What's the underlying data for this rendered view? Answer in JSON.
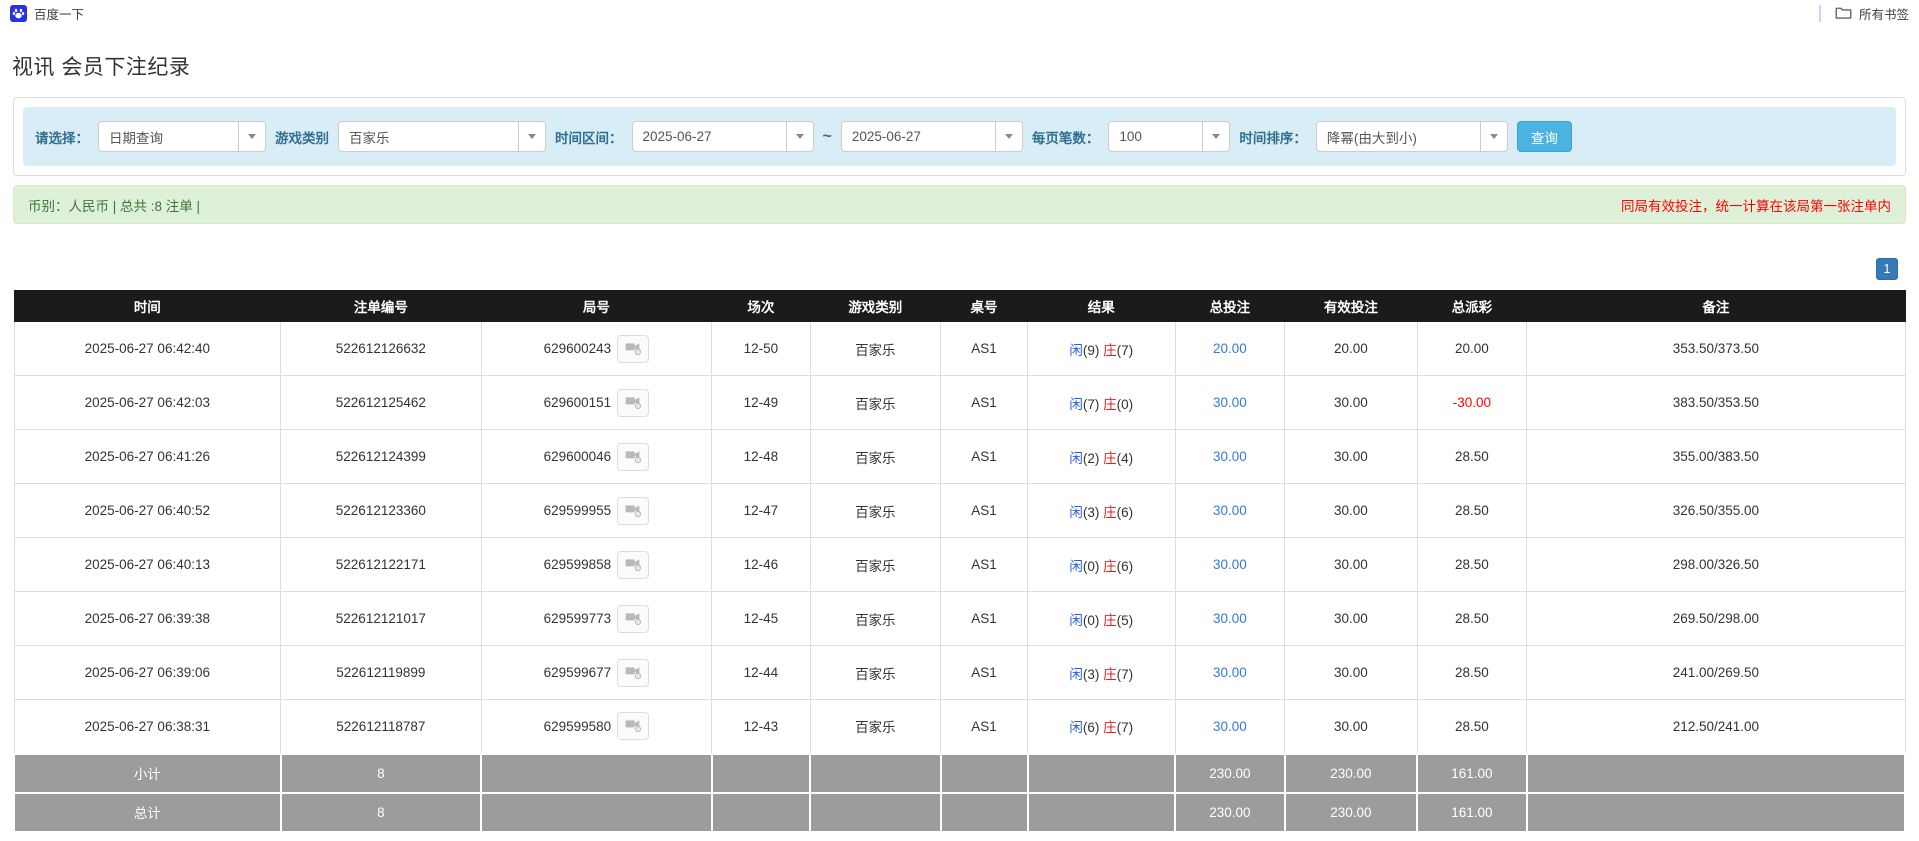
{
  "bookmarks_bar": {
    "baidu_label": "百度一下",
    "all_bookmarks_label": "所有书签"
  },
  "page": {
    "title": "视讯 会员下注纪录"
  },
  "filters": {
    "select_label": "请选择：",
    "select_value": "日期查询",
    "game_category_label": "游戏类别",
    "game_category_value": "百家乐",
    "time_range_label": "时间区间：",
    "date_from": "2025-06-27",
    "range_separator": "~",
    "date_to": "2025-06-27",
    "page_size_label": "每页笔数：",
    "page_size_value": "100",
    "sort_label": "时间排序：",
    "sort_value": "降幂(由大到小)",
    "search_button": "查询"
  },
  "summary_bar": {
    "left_text": "币别：人民币 | 总共 :8 注单 |",
    "right_text": "同局有效投注，统一计算在该局第一张注单内"
  },
  "pagination": {
    "current_page": "1"
  },
  "colors": {
    "filter_bg": "#d9edf7",
    "filter_label": "#31708f",
    "search_button_bg": "#4cb3e0",
    "summary_bg": "#dff0d8",
    "summary_text": "#3c763d",
    "notice_red": "#ff0000",
    "header_bg": "#1b1b1b",
    "player_blue": "#2b5fd9",
    "banker_red": "#e02222",
    "bet_link_blue": "#3579d8",
    "sum_row_bg": "#9c9c9c",
    "pagination_blue": "#337ab7",
    "baidu_blue": "#2932e1"
  },
  "table": {
    "headers": [
      "时间",
      "注单编号",
      "局号",
      "场次",
      "游戏类别",
      "桌号",
      "结果",
      "总投注",
      "有效投注",
      "总派彩",
      "备注"
    ],
    "col_widths": [
      "14.1%",
      "10.6%",
      "12.2%",
      "5.2%",
      "6.9%",
      "4.6%",
      "7.8%",
      "5.8%",
      "7.0%",
      "5.8%",
      "20.0%"
    ],
    "rows": [
      {
        "time": "2025-06-27 06:42:40",
        "bet_id": "522612126632",
        "round_id": "629600243",
        "session": "12-50",
        "game": "百家乐",
        "table_no": "AS1",
        "result": {
          "player": "闲",
          "player_count": "(9)",
          "banker": "庄",
          "banker_count": "(7)"
        },
        "total_bet": "20.00",
        "valid_bet": "20.00",
        "payout": "20.00",
        "remark": "353.50/373.50"
      },
      {
        "time": "2025-06-27 06:42:03",
        "bet_id": "522612125462",
        "round_id": "629600151",
        "session": "12-49",
        "game": "百家乐",
        "table_no": "AS1",
        "result": {
          "player": "闲",
          "player_count": "(7)",
          "banker": "庄",
          "banker_count": "(0)"
        },
        "total_bet": "30.00",
        "valid_bet": "30.00",
        "payout": "-30.00",
        "remark": "383.50/353.50"
      },
      {
        "time": "2025-06-27 06:41:26",
        "bet_id": "522612124399",
        "round_id": "629600046",
        "session": "12-48",
        "game": "百家乐",
        "table_no": "AS1",
        "result": {
          "player": "闲",
          "player_count": "(2)",
          "banker": "庄",
          "banker_count": "(4)"
        },
        "total_bet": "30.00",
        "valid_bet": "30.00",
        "payout": "28.50",
        "remark": "355.00/383.50"
      },
      {
        "time": "2025-06-27 06:40:52",
        "bet_id": "522612123360",
        "round_id": "629599955",
        "session": "12-47",
        "game": "百家乐",
        "table_no": "AS1",
        "result": {
          "player": "闲",
          "player_count": "(3)",
          "banker": "庄",
          "banker_count": "(6)"
        },
        "total_bet": "30.00",
        "valid_bet": "30.00",
        "payout": "28.50",
        "remark": "326.50/355.00"
      },
      {
        "time": "2025-06-27 06:40:13",
        "bet_id": "522612122171",
        "round_id": "629599858",
        "session": "12-46",
        "game": "百家乐",
        "table_no": "AS1",
        "result": {
          "player": "闲",
          "player_count": "(0)",
          "banker": "庄",
          "banker_count": "(6)"
        },
        "total_bet": "30.00",
        "valid_bet": "30.00",
        "payout": "28.50",
        "remark": "298.00/326.50"
      },
      {
        "time": "2025-06-27 06:39:38",
        "bet_id": "522612121017",
        "round_id": "629599773",
        "session": "12-45",
        "game": "百家乐",
        "table_no": "AS1",
        "result": {
          "player": "闲",
          "player_count": "(0)",
          "banker": "庄",
          "banker_count": "(5)"
        },
        "total_bet": "30.00",
        "valid_bet": "30.00",
        "payout": "28.50",
        "remark": "269.50/298.00"
      },
      {
        "time": "2025-06-27 06:39:06",
        "bet_id": "522612119899",
        "round_id": "629599677",
        "session": "12-44",
        "game": "百家乐",
        "table_no": "AS1",
        "result": {
          "player": "闲",
          "player_count": "(3)",
          "banker": "庄",
          "banker_count": "(7)"
        },
        "total_bet": "30.00",
        "valid_bet": "30.00",
        "payout": "28.50",
        "remark": "241.00/269.50"
      },
      {
        "time": "2025-06-27 06:38:31",
        "bet_id": "522612118787",
        "round_id": "629599580",
        "session": "12-43",
        "game": "百家乐",
        "table_no": "AS1",
        "result": {
          "player": "闲",
          "player_count": "(6)",
          "banker": "庄",
          "banker_count": "(7)"
        },
        "total_bet": "30.00",
        "valid_bet": "30.00",
        "payout": "28.50",
        "remark": "212.50/241.00"
      }
    ],
    "subtotal": {
      "label": "小计",
      "count": "8",
      "total_bet": "230.00",
      "valid_bet": "230.00",
      "total_payout": "161.00"
    },
    "total": {
      "label": "总计",
      "count": "8",
      "total_bet": "230.00",
      "valid_bet": "230.00",
      "total_payout": "161.00"
    }
  }
}
